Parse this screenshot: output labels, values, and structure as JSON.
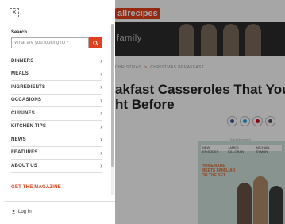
{
  "header": {
    "logo_text": "allrecipes",
    "hero_brand": "family"
  },
  "article": {
    "breadcrumb": [
      "CHRISTMAS",
      "CHRISTMAS BREAKFAST"
    ],
    "breadcrumb_sep": ">",
    "title_line1": "akfast Casseroles That You",
    "title_line2": "ht Before",
    "advertisement": "Advertisement",
    "promo_text": "HOMEMADE MEETS FAMILIAR ON THE SET",
    "promo_badges": [
      "NEW EPISODES",
      "JAMES KILLORAN",
      "MICHAEL SYMON"
    ]
  },
  "drawer": {
    "close_icon": "×",
    "search": {
      "label": "Search",
      "placeholder": "What are you looking for?"
    },
    "nav": [
      {
        "label": "DINNERS"
      },
      {
        "label": "MEALS"
      },
      {
        "label": "INGREDIENTS"
      },
      {
        "label": "OCCASIONS"
      },
      {
        "label": "CUISINES"
      },
      {
        "label": "KITCHEN TIPS"
      },
      {
        "label": "NEWS"
      },
      {
        "label": "FEATURES"
      },
      {
        "label": "ABOUT US"
      }
    ],
    "chevron": "›",
    "magazine": "GET THE MAGAZINE",
    "login": "Log In"
  },
  "colors": {
    "brand": "#e53e1a",
    "facebook": "#3b5998",
    "twitter": "#1da1f2",
    "pinterest": "#e60023",
    "email": "#555555"
  }
}
